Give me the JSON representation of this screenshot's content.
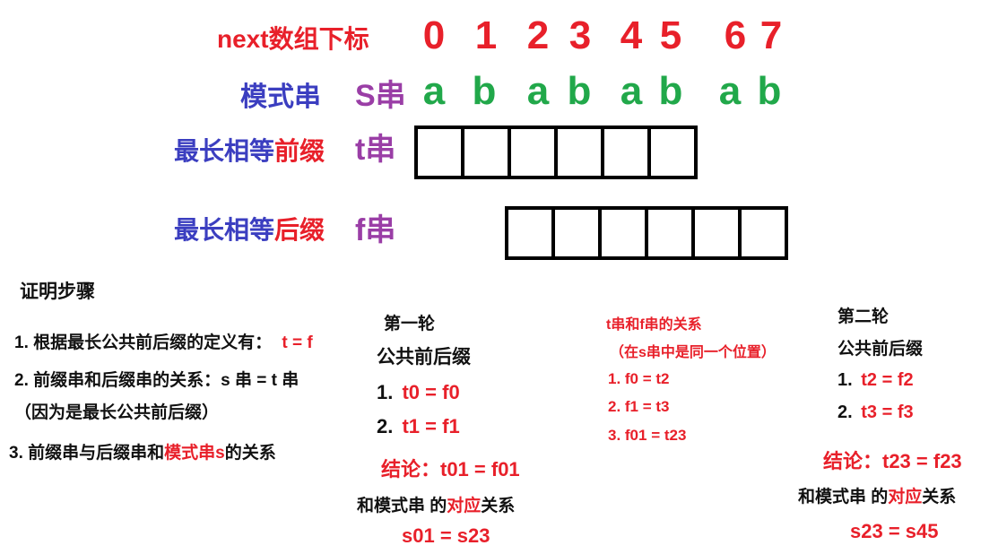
{
  "header": {
    "index_label": "next数组下标",
    "indices": [
      "0",
      "1",
      "2",
      "3",
      "4",
      "5",
      "6",
      "7"
    ],
    "pattern_label": "模式串",
    "s_label": "S串",
    "letters": [
      "a",
      "b",
      "a",
      "b",
      "a",
      "b",
      "a",
      "b"
    ]
  },
  "prefix_row": {
    "label_part1": "最长相等",
    "label_part2": "前缀",
    "tag": "t串"
  },
  "suffix_row": {
    "label_part1": "最长相等",
    "label_part2": "后缀",
    "tag": "f串"
  },
  "proof": {
    "title": "证明步骤",
    "step1": {
      "text": "1. 根据最长公共前后缀的定义有：",
      "value": "t = f"
    },
    "step2": {
      "text": "2. 前缀串和后缀串的关系：s 串 = t 串",
      "note": "（因为是最长公共前后缀）"
    },
    "step3": {
      "part1": "3. 前缀串与后缀串和",
      "part2": "模式串s",
      "part3": "的关系"
    }
  },
  "round1": {
    "title": "第一轮",
    "subtitle": "公共前后缀",
    "line1_num": "1.",
    "line1_val": "t0 = f0",
    "line2_num": "2.",
    "line2_val": "t1 = f1",
    "conclusion": "结论：t01 = f01",
    "relation_part1": "和模式串 的",
    "relation_part2": "对应",
    "relation_part3": "关系",
    "result": "s01 = s23"
  },
  "relation": {
    "title": "t串和f串的关系",
    "note": "（在s串中是同一个位置）",
    "items": [
      "1. f0 = t2",
      "2. f1 = t3",
      "3. f01 = t23"
    ]
  },
  "round2": {
    "title": "第二轮",
    "subtitle": "公共前后缀",
    "line1_num": "1.",
    "line1_val": "t2 = f2",
    "line2_num": "2.",
    "line2_val": "t3 = f3",
    "conclusion": "结论：t23 = f23",
    "relation_part1": "和模式串 的",
    "relation_part2": "对应",
    "relation_part3": "关系",
    "result": "s23 = s45"
  }
}
